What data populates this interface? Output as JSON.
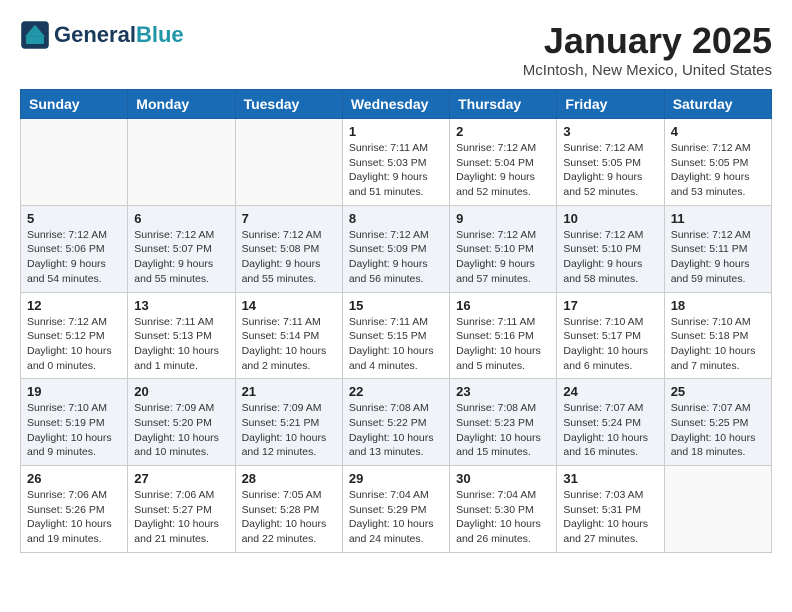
{
  "header": {
    "logo_line1": "General",
    "logo_line2": "Blue",
    "title": "January 2025",
    "subtitle": "McIntosh, New Mexico, United States"
  },
  "days_of_week": [
    "Sunday",
    "Monday",
    "Tuesday",
    "Wednesday",
    "Thursday",
    "Friday",
    "Saturday"
  ],
  "weeks": [
    [
      {
        "day": "",
        "info": ""
      },
      {
        "day": "",
        "info": ""
      },
      {
        "day": "",
        "info": ""
      },
      {
        "day": "1",
        "info": "Sunrise: 7:11 AM\nSunset: 5:03 PM\nDaylight: 9 hours\nand 51 minutes."
      },
      {
        "day": "2",
        "info": "Sunrise: 7:12 AM\nSunset: 5:04 PM\nDaylight: 9 hours\nand 52 minutes."
      },
      {
        "day": "3",
        "info": "Sunrise: 7:12 AM\nSunset: 5:05 PM\nDaylight: 9 hours\nand 52 minutes."
      },
      {
        "day": "4",
        "info": "Sunrise: 7:12 AM\nSunset: 5:05 PM\nDaylight: 9 hours\nand 53 minutes."
      }
    ],
    [
      {
        "day": "5",
        "info": "Sunrise: 7:12 AM\nSunset: 5:06 PM\nDaylight: 9 hours\nand 54 minutes."
      },
      {
        "day": "6",
        "info": "Sunrise: 7:12 AM\nSunset: 5:07 PM\nDaylight: 9 hours\nand 55 minutes."
      },
      {
        "day": "7",
        "info": "Sunrise: 7:12 AM\nSunset: 5:08 PM\nDaylight: 9 hours\nand 55 minutes."
      },
      {
        "day": "8",
        "info": "Sunrise: 7:12 AM\nSunset: 5:09 PM\nDaylight: 9 hours\nand 56 minutes."
      },
      {
        "day": "9",
        "info": "Sunrise: 7:12 AM\nSunset: 5:10 PM\nDaylight: 9 hours\nand 57 minutes."
      },
      {
        "day": "10",
        "info": "Sunrise: 7:12 AM\nSunset: 5:10 PM\nDaylight: 9 hours\nand 58 minutes."
      },
      {
        "day": "11",
        "info": "Sunrise: 7:12 AM\nSunset: 5:11 PM\nDaylight: 9 hours\nand 59 minutes."
      }
    ],
    [
      {
        "day": "12",
        "info": "Sunrise: 7:12 AM\nSunset: 5:12 PM\nDaylight: 10 hours\nand 0 minutes."
      },
      {
        "day": "13",
        "info": "Sunrise: 7:11 AM\nSunset: 5:13 PM\nDaylight: 10 hours\nand 1 minute."
      },
      {
        "day": "14",
        "info": "Sunrise: 7:11 AM\nSunset: 5:14 PM\nDaylight: 10 hours\nand 2 minutes."
      },
      {
        "day": "15",
        "info": "Sunrise: 7:11 AM\nSunset: 5:15 PM\nDaylight: 10 hours\nand 4 minutes."
      },
      {
        "day": "16",
        "info": "Sunrise: 7:11 AM\nSunset: 5:16 PM\nDaylight: 10 hours\nand 5 minutes."
      },
      {
        "day": "17",
        "info": "Sunrise: 7:10 AM\nSunset: 5:17 PM\nDaylight: 10 hours\nand 6 minutes."
      },
      {
        "day": "18",
        "info": "Sunrise: 7:10 AM\nSunset: 5:18 PM\nDaylight: 10 hours\nand 7 minutes."
      }
    ],
    [
      {
        "day": "19",
        "info": "Sunrise: 7:10 AM\nSunset: 5:19 PM\nDaylight: 10 hours\nand 9 minutes."
      },
      {
        "day": "20",
        "info": "Sunrise: 7:09 AM\nSunset: 5:20 PM\nDaylight: 10 hours\nand 10 minutes."
      },
      {
        "day": "21",
        "info": "Sunrise: 7:09 AM\nSunset: 5:21 PM\nDaylight: 10 hours\nand 12 minutes."
      },
      {
        "day": "22",
        "info": "Sunrise: 7:08 AM\nSunset: 5:22 PM\nDaylight: 10 hours\nand 13 minutes."
      },
      {
        "day": "23",
        "info": "Sunrise: 7:08 AM\nSunset: 5:23 PM\nDaylight: 10 hours\nand 15 minutes."
      },
      {
        "day": "24",
        "info": "Sunrise: 7:07 AM\nSunset: 5:24 PM\nDaylight: 10 hours\nand 16 minutes."
      },
      {
        "day": "25",
        "info": "Sunrise: 7:07 AM\nSunset: 5:25 PM\nDaylight: 10 hours\nand 18 minutes."
      }
    ],
    [
      {
        "day": "26",
        "info": "Sunrise: 7:06 AM\nSunset: 5:26 PM\nDaylight: 10 hours\nand 19 minutes."
      },
      {
        "day": "27",
        "info": "Sunrise: 7:06 AM\nSunset: 5:27 PM\nDaylight: 10 hours\nand 21 minutes."
      },
      {
        "day": "28",
        "info": "Sunrise: 7:05 AM\nSunset: 5:28 PM\nDaylight: 10 hours\nand 22 minutes."
      },
      {
        "day": "29",
        "info": "Sunrise: 7:04 AM\nSunset: 5:29 PM\nDaylight: 10 hours\nand 24 minutes."
      },
      {
        "day": "30",
        "info": "Sunrise: 7:04 AM\nSunset: 5:30 PM\nDaylight: 10 hours\nand 26 minutes."
      },
      {
        "day": "31",
        "info": "Sunrise: 7:03 AM\nSunset: 5:31 PM\nDaylight: 10 hours\nand 27 minutes."
      },
      {
        "day": "",
        "info": ""
      }
    ]
  ]
}
